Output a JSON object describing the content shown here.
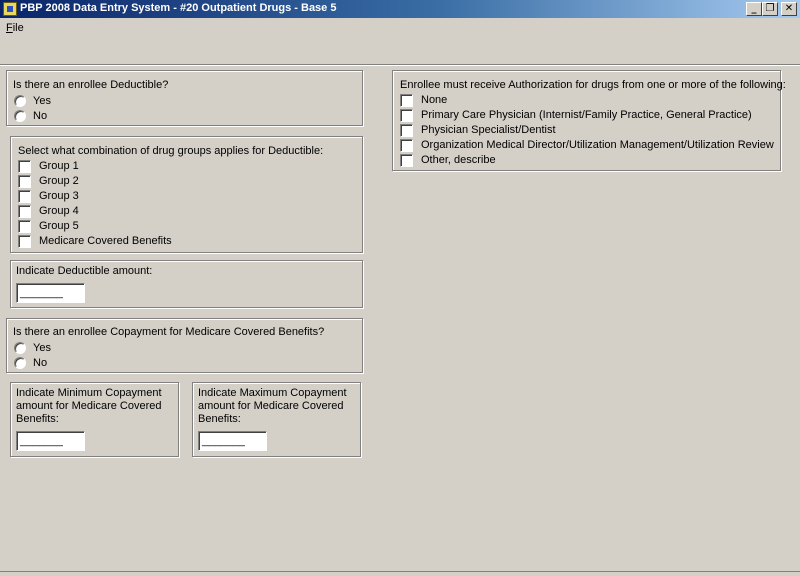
{
  "window": {
    "title": "PBP 2008 Data Entry System - #20 Outpatient Drugs - Base 5",
    "min_glyph": "_",
    "restore_glyph": "❐",
    "close_glyph": "✕"
  },
  "menu": {
    "file_accel": "F",
    "file_rest": "ile"
  },
  "deductible": {
    "question": "Is there an enrollee Deductible?",
    "options": [
      "Yes",
      "No"
    ]
  },
  "drug_groups": {
    "prompt": "Select what combination of drug groups applies for Deductible:",
    "items": [
      "Group 1",
      "Group 2",
      "Group 3",
      "Group 4",
      "Group 5",
      "Medicare Covered Benefits"
    ]
  },
  "deductible_amount": {
    "label": "Indicate Deductible amount:",
    "value": "_______"
  },
  "copayment": {
    "question": "Is there an enrollee Copayment for Medicare Covered Benefits?",
    "options": [
      "Yes",
      "No"
    ]
  },
  "min_copay": {
    "label": "Indicate Minimum Copayment amount for Medicare Covered Benefits:",
    "value": "_______"
  },
  "max_copay": {
    "label": "Indicate Maximum Copayment amount for Medicare Covered Benefits:",
    "value": "_______"
  },
  "authorization": {
    "prompt": "Enrollee must receive Authorization for drugs from one or more of the following:",
    "items": [
      "None",
      "Primary Care Physician (Internist/Family Practice, General Practice)",
      "Physician Specialist/Dentist",
      "Organization Medical Director/Utilization Management/Utilization Review",
      "Other, describe"
    ]
  }
}
